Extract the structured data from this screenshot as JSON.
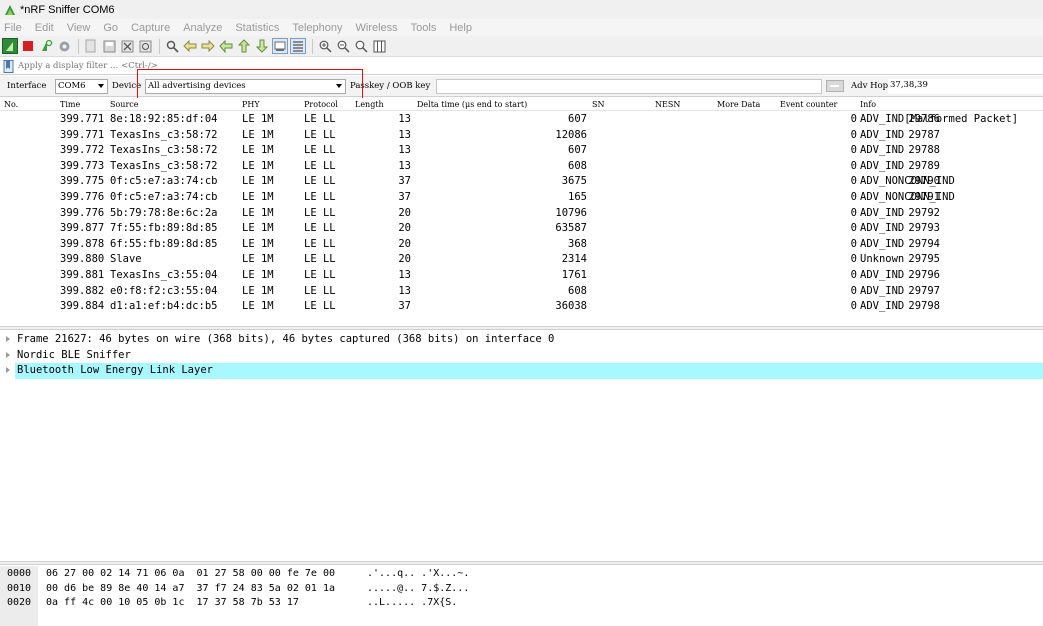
{
  "window": {
    "title": "*nRF Sniffer COM6"
  },
  "menu": [
    "File",
    "Edit",
    "View",
    "Go",
    "Capture",
    "Analyze",
    "Statistics",
    "Telephony",
    "Wireless",
    "Tools",
    "Help"
  ],
  "filter": {
    "placeholder": "Apply a display filter … <Ctrl-/>"
  },
  "sniffer": {
    "interface_label": "Interface",
    "interface_value": "COM6",
    "device_label": "Device",
    "device_value": "All advertising devices",
    "passkey_label": "Passkey / OOB key",
    "advhop_label": "Adv Hop",
    "advhop_value": "37,38,39"
  },
  "columns": [
    "No.",
    "Time",
    "Source",
    "PHY",
    "Protocol",
    "Length",
    "Delta time (μs end to start)",
    "SN",
    "NESN",
    "More Data",
    "Event counter",
    "Info"
  ],
  "packets": [
    {
      "no": "29786",
      "time": "399.771",
      "source": "8e:18:92:85:df:04",
      "phy": "LE 1M",
      "protocol": "LE LL",
      "length": "13",
      "delta": "607",
      "event": "0",
      "info": "ADV_IND[Malformed Packet]"
    },
    {
      "no": "29787",
      "time": "399.771",
      "source": "TexasIns_c3:58:72",
      "phy": "LE 1M",
      "protocol": "LE LL",
      "length": "13",
      "delta": "12086",
      "event": "0",
      "info": "ADV_IND"
    },
    {
      "no": "29788",
      "time": "399.772",
      "source": "TexasIns_c3:58:72",
      "phy": "LE 1M",
      "protocol": "LE LL",
      "length": "13",
      "delta": "607",
      "event": "0",
      "info": "ADV_IND"
    },
    {
      "no": "29789",
      "time": "399.773",
      "source": "TexasIns_c3:58:72",
      "phy": "LE 1M",
      "protocol": "LE LL",
      "length": "13",
      "delta": "608",
      "event": "0",
      "info": "ADV_IND"
    },
    {
      "no": "29790",
      "time": "399.775",
      "source": "0f:c5:e7:a3:74:cb",
      "phy": "LE 1M",
      "protocol": "LE LL",
      "length": "37",
      "delta": "3675",
      "event": "0",
      "info": "ADV_NONCONN_IND"
    },
    {
      "no": "29791",
      "time": "399.776",
      "source": "0f:c5:e7:a3:74:cb",
      "phy": "LE 1M",
      "protocol": "LE LL",
      "length": "37",
      "delta": "165",
      "event": "0",
      "info": "ADV_NONCONN_IND"
    },
    {
      "no": "29792",
      "time": "399.776",
      "source": "5b:79:78:8e:6c:2a",
      "phy": "LE 1M",
      "protocol": "LE LL",
      "length": "20",
      "delta": "10796",
      "event": "0",
      "info": "ADV_IND"
    },
    {
      "no": "29793",
      "time": "399.877",
      "source": "7f:55:fb:89:8d:85",
      "phy": "LE 1M",
      "protocol": "LE LL",
      "length": "20",
      "delta": "63587",
      "event": "0",
      "info": "ADV_IND"
    },
    {
      "no": "29794",
      "time": "399.878",
      "source": "6f:55:fb:89:8d:85",
      "phy": "LE 1M",
      "protocol": "LE LL",
      "length": "20",
      "delta": "368",
      "event": "0",
      "info": "ADV_IND"
    },
    {
      "no": "29795",
      "time": "399.880",
      "source": "Slave",
      "phy": "LE 1M",
      "protocol": "LE LL",
      "length": "20",
      "delta": "2314",
      "event": "0",
      "info": "Unknown"
    },
    {
      "no": "29796",
      "time": "399.881",
      "source": "TexasIns_c3:55:04",
      "phy": "LE 1M",
      "protocol": "LE LL",
      "length": "13",
      "delta": "1761",
      "event": "0",
      "info": "ADV_IND"
    },
    {
      "no": "29797",
      "time": "399.882",
      "source": "e0:f8:f2:c3:55:04",
      "phy": "LE 1M",
      "protocol": "LE LL",
      "length": "13",
      "delta": "608",
      "event": "0",
      "info": "ADV_IND"
    },
    {
      "no": "29798",
      "time": "399.884",
      "source": "d1:a1:ef:b4:dc:b5",
      "phy": "LE 1M",
      "protocol": "LE LL",
      "length": "37",
      "delta": "36038",
      "event": "0",
      "info": "ADV_IND"
    }
  ],
  "details": [
    {
      "text": "Frame 21627: 46 bytes on wire (368 bits), 46 bytes captured (368 bits) on interface 0",
      "selected": false
    },
    {
      "text": "Nordic BLE Sniffer",
      "selected": false
    },
    {
      "text": "Bluetooth Low Energy Link Layer",
      "selected": true
    }
  ],
  "bytes": [
    {
      "offset": "0000",
      "hex": "06 27 00 02 14 71 06 0a  01 27 58 00 00 fe 7e 00",
      "ascii": ".'...q.. .'X...~."
    },
    {
      "offset": "0010",
      "hex": "00 d6 be 89 8e 40 14 a7  37 f7 24 83 5a 02 01 1a",
      "ascii": ".....@.. 7.$.Z..."
    },
    {
      "offset": "0020",
      "hex": "0a ff 4c 00 10 05 0b 1c  17 37 58 7b 53 17",
      "ascii": "..L..... .7X{S."
    }
  ],
  "colors": {
    "selected_row": "#a8f8ff",
    "highlight_box": "#e01010",
    "menu_text": "#9a9a9a"
  }
}
